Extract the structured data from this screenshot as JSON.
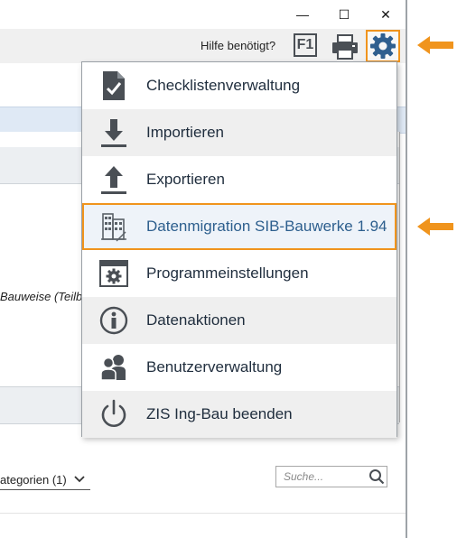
{
  "window": {
    "controls": {
      "minimize": "—",
      "maximize": "☐",
      "close": "✕"
    }
  },
  "toolbar": {
    "help_text": "Hilfe benötigt?",
    "f1_label": "F1",
    "print_icon": "printer-icon",
    "settings_icon": "gear-icon"
  },
  "background": {
    "partial_text": "Bauweise (Teilb",
    "categories_label": "ategorien (1)",
    "search_placeholder": "Suche..."
  },
  "menu": {
    "items": [
      {
        "label": "Checklistenverwaltung",
        "icon": "checklist-icon"
      },
      {
        "label": "Importieren",
        "icon": "import-icon"
      },
      {
        "label": "Exportieren",
        "icon": "export-icon"
      },
      {
        "label": "Datenmigration SIB-Bauwerke 1.94",
        "icon": "building-migration-icon",
        "highlighted": true
      },
      {
        "label": "Programmeinstellungen",
        "icon": "settings-window-icon"
      },
      {
        "label": "Datenaktionen",
        "icon": "info-icon"
      },
      {
        "label": "Benutzerverwaltung",
        "icon": "users-icon"
      },
      {
        "label": "ZIS Ing-Bau beenden",
        "icon": "power-icon"
      }
    ]
  },
  "colors": {
    "accent_orange": "#f0941d",
    "icon_dark": "#4a4f55",
    "highlight_text": "#2d5f8e",
    "row_alt": "#efefef"
  }
}
